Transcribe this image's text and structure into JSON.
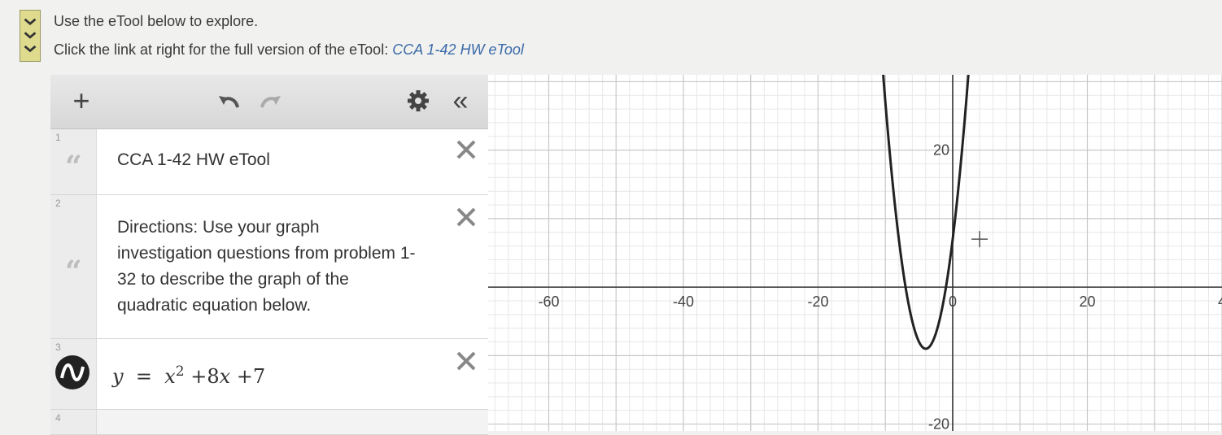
{
  "header": {
    "line1": "Use the eTool below to explore.",
    "line2_prefix": "Click the link at right for the full version of the eTool: ",
    "link_text": "CCA 1-42 HW eTool"
  },
  "toolbar": {
    "add_glyph": "+",
    "collapse_glyph": "«"
  },
  "expressions": [
    {
      "number": "1",
      "type": "note",
      "text": "CCA 1-42 HW eTool"
    },
    {
      "number": "2",
      "type": "note",
      "lines": [
        "Directions: Use your graph",
        "investigation questions from problem 1-",
        "32 to describe the graph of the",
        "quadratic equation below."
      ]
    },
    {
      "number": "3",
      "type": "expression",
      "lhs": "y",
      "eq": "=",
      "var": "x",
      "exp": "2",
      "term2": "+8",
      "term2_var": "x",
      "term3": "+7"
    },
    {
      "number": "4",
      "type": "empty"
    }
  ],
  "chart_data": {
    "type": "line",
    "expression": "y = x^2 + 8x + 7",
    "xlim": [
      -69,
      40
    ],
    "ylim": [
      -21,
      31
    ],
    "x_ticks": [
      "-60",
      "-40",
      "-20",
      "0",
      "20",
      "4"
    ],
    "y_ticks": [
      "20",
      "-20"
    ],
    "grid": true,
    "series": [
      {
        "x": [
          -13,
          -12,
          -10,
          -8,
          -6,
          -4,
          -2,
          0,
          2,
          4,
          5
        ],
        "y": [
          72,
          55,
          27,
          7,
          -5,
          -9,
          -5,
          7,
          27,
          55,
          72
        ]
      }
    ]
  },
  "colors": {
    "curve": "#222222",
    "grid_major": "#c8c8c8",
    "grid_minor": "#e7e7e7",
    "axis": "#333333",
    "link": "#3a6aa8"
  }
}
